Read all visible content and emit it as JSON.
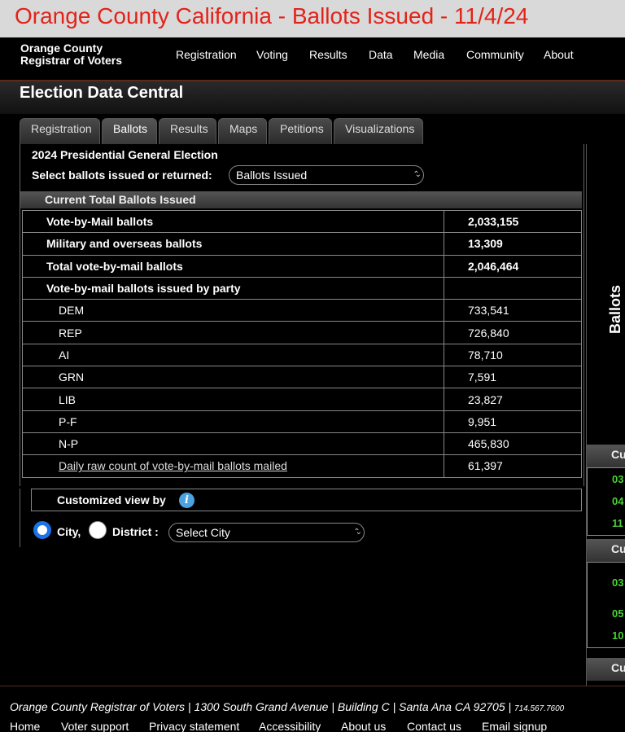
{
  "banner": {
    "title": "Orange County California - Ballots Issued - 11/4/24"
  },
  "header": {
    "logo_line1": "Orange County",
    "logo_line2": "Registrar of Voters",
    "nav": [
      "Registration",
      "Voting",
      "Results",
      "Data",
      "Media",
      "Community",
      "About"
    ]
  },
  "page_title": "Election Data Central",
  "tabs": [
    "Registration",
    "Ballots",
    "Results",
    "Maps",
    "Petitions",
    "Visualizations"
  ],
  "active_tab": "Ballots",
  "election_title": "2024 Presidential General Election",
  "select_label": "Select ballots issued or returned:",
  "select_value": "Ballots Issued",
  "section_title": "Current Total Ballots Issued",
  "rows": [
    {
      "label": "Vote-by-Mail ballots",
      "value": "2,033,155"
    },
    {
      "label": "Military and overseas ballots",
      "value": "13,309"
    },
    {
      "label": "Total vote-by-mail ballots",
      "value": "2,046,464"
    },
    {
      "label": "Vote-by-mail ballots issued by party",
      "value": ""
    }
  ],
  "party_rows": [
    {
      "label": "DEM",
      "value": "733,541"
    },
    {
      "label": "REP",
      "value": "726,840"
    },
    {
      "label": "AI",
      "value": "78,710"
    },
    {
      "label": "GRN",
      "value": "7,591"
    },
    {
      "label": "LIB",
      "value": "23,827"
    },
    {
      "label": "P-F",
      "value": "9,951"
    },
    {
      "label": "N-P",
      "value": "465,830"
    }
  ],
  "daily_row": {
    "label": "Daily raw count of vote-by-mail ballots mailed",
    "value": "61,397"
  },
  "custom_view": {
    "label": "Customized view by",
    "info_icon": "i",
    "radio_city": "City,",
    "radio_district": "District :",
    "select_placeholder": "Select City"
  },
  "sidebar": {
    "label": "Ballots",
    "head1": "Cu",
    "vals1": [
      "03",
      "04",
      "11"
    ],
    "head2": "Cu",
    "vals2": [
      "03",
      "05",
      "10"
    ],
    "head3": "Cu"
  },
  "footer": {
    "address": "Orange County Registrar of Voters | 1300 South Grand Avenue | Building C | Santa Ana CA 92705 | ",
    "phone": "714.567.7600",
    "links": [
      "Home",
      "Voter support",
      "Privacy statement",
      "Accessibility",
      "About us",
      "Contact us",
      "Email signup"
    ]
  },
  "colors": {
    "accent_red": "#e2231a",
    "radio_blue": "#1a73e8",
    "info_blue": "#4aa3df",
    "sidebar_green": "#4cd137"
  }
}
